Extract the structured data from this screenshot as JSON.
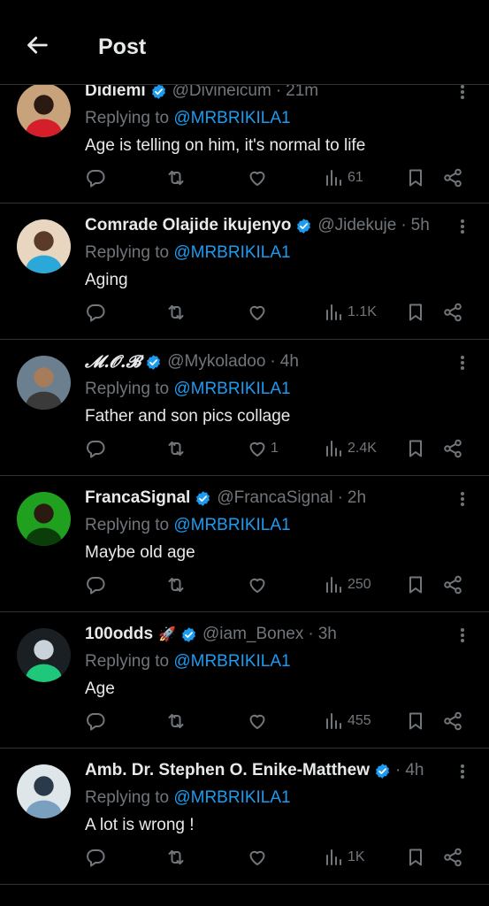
{
  "header": {
    "title": "Post"
  },
  "replying_prefix": "Replying to",
  "replies": [
    {
      "name": "Didiemi",
      "handle": "@Divineicum",
      "time": "21m",
      "mention": "@MRBRIKILA1",
      "text": "Age is telling on him, it's normal to life",
      "views": "61",
      "likes": "",
      "emoji": "",
      "avatar_colors": [
        "#c8a27a",
        "#d41f2a",
        "#2a1a12"
      ]
    },
    {
      "name": "Comrade Olajide ikujenyo",
      "handle": "@Jidekuje",
      "time": "5h",
      "mention": "@MRBRIKILA1",
      "text": "Aging",
      "views": "1.1K",
      "likes": "",
      "emoji": "",
      "avatar_colors": [
        "#e8d6c0",
        "#2aa8d8",
        "#5a3a28"
      ]
    },
    {
      "name": "𝓜.𝓞.𝓑",
      "handle": "@Mykoladoo",
      "time": "4h",
      "mention": "@MRBRIKILA1",
      "text": "Father and son pics collage",
      "views": "2.4K",
      "likes": "1",
      "emoji": "",
      "avatar_colors": [
        "#6b7f8f",
        "#3a3a3a",
        "#a67c5a"
      ]
    },
    {
      "name": "FrancaSignal",
      "handle": "@FrancaSignal",
      "time": "2h",
      "mention": "@MRBRIKILA1",
      "text": "Maybe old age",
      "views": "250",
      "likes": "",
      "emoji": "",
      "avatar_colors": [
        "#1fa01f",
        "#0b3d0b",
        "#2a1a10"
      ]
    },
    {
      "name": "100odds",
      "handle": "@iam_Bonex",
      "time": "3h",
      "mention": "@MRBRIKILA1",
      "text": "Age",
      "views": "455",
      "likes": "",
      "emoji": "🚀",
      "avatar_colors": [
        "#1a1f24",
        "#1fc77a",
        "#c9d1d9"
      ]
    },
    {
      "name": "Amb. Dr. Stephen O. Enike-Matthew",
      "handle": "",
      "time": "4h",
      "mention": "@MRBRIKILA1",
      "text": "A lot is wrong !",
      "views": "1K",
      "likes": "",
      "emoji": "",
      "avatar_colors": [
        "#dfe6ea",
        "#7aa0c0",
        "#2a3a4a"
      ]
    }
  ]
}
